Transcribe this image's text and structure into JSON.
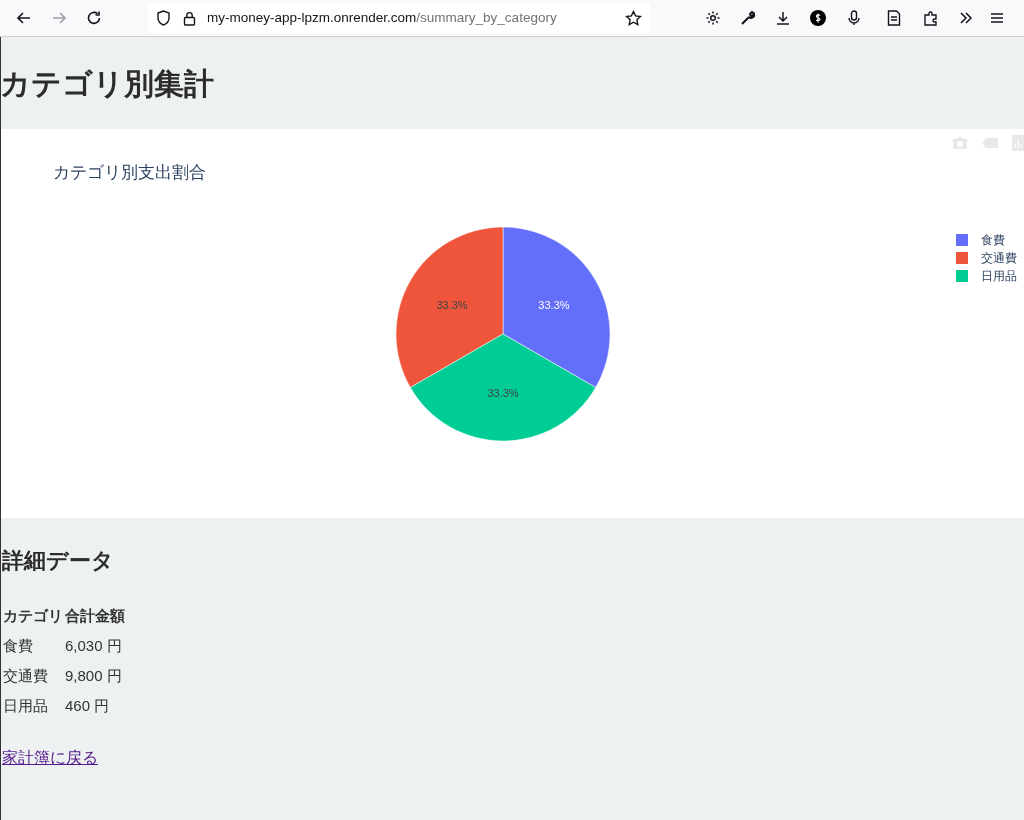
{
  "browser": {
    "url_host": "my-money-app-lpzm.onrender.com",
    "url_path": "/summary_by_category"
  },
  "page_title": "カテゴリ別集計",
  "chart": {
    "chart_data": {
      "type": "pie",
      "title": "カテゴリ別支出割合",
      "categories": [
        "食費",
        "交通費",
        "日用品"
      ],
      "values": [
        33.3,
        33.3,
        33.3
      ],
      "colors": [
        "#636efa",
        "#ef553b",
        "#00cc96"
      ],
      "data_labels": true,
      "legend": true,
      "value_labels": [
        "33.3%",
        "33.3%",
        "33.3%"
      ]
    }
  },
  "details": {
    "heading": "詳細データ",
    "columns": [
      "カテゴリ",
      "合計金額"
    ],
    "rows": [
      [
        "食費",
        "6,030 円"
      ],
      [
        "交通費",
        "9,800 円"
      ],
      [
        "日用品",
        "460 円"
      ]
    ]
  },
  "back_link": "家計簿に戻る"
}
